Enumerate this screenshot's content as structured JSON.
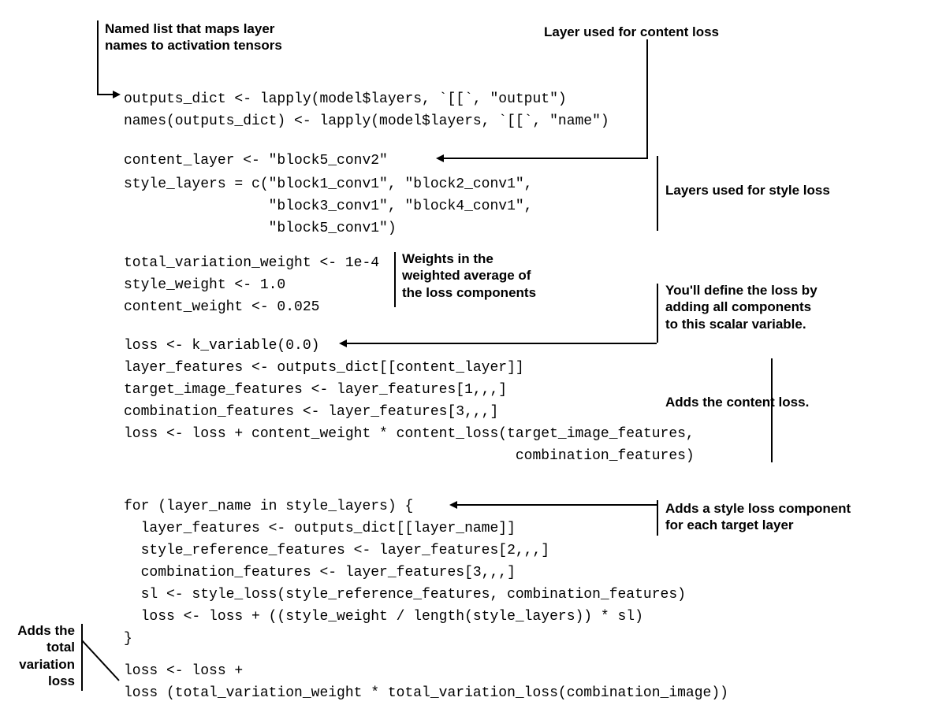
{
  "annotations": {
    "top_left": "Named list that maps layer\nnames to activation tensors",
    "top_right": "Layer used for content loss",
    "style_layers": "Layers used for style loss",
    "weights": "Weights in the\nweighted average of\nthe loss components",
    "scalar_var": "You'll define the loss by\nadding all components\nto this scalar variable.",
    "content_loss": "Adds the content loss.",
    "style_loop": "Adds a style loss component\nfor each target layer",
    "tv_loss": "Adds the\ntotal\nvariation\nloss"
  },
  "code": {
    "l1": "outputs_dict <- lapply(model$layers, `[[`, \"output\")",
    "l2": "names(outputs_dict) <- lapply(model$layers, `[[`, \"name\")",
    "l3": "content_layer <- \"block5_conv2\"",
    "l4": "style_layers = c(\"block1_conv1\", \"block2_conv1\",",
    "l5": "                 \"block3_conv1\", \"block4_conv1\",",
    "l6": "                 \"block5_conv1\")",
    "l7": "total_variation_weight <- 1e-4",
    "l8": "style_weight <- 1.0",
    "l9": "content_weight <- 0.025",
    "l10": "loss <- k_variable(0.0)",
    "l11": "layer_features <- outputs_dict[[content_layer]]",
    "l12": "target_image_features <- layer_features[1,,,]",
    "l13": "combination_features <- layer_features[3,,,]",
    "l14": "loss <- loss + content_weight * content_loss(target_image_features,",
    "l15": "                                              combination_features)",
    "l16": "for (layer_name in style_layers) {",
    "l17": "  layer_features <- outputs_dict[[layer_name]]",
    "l18": "  style_reference_features <- layer_features[2,,,]",
    "l19": "  combination_features <- layer_features[3,,,]",
    "l20": "  sl <- style_loss(style_reference_features, combination_features)",
    "l21": "  loss <- loss + ((style_weight / length(style_layers)) * sl)",
    "l22": "}",
    "l23": "loss <- loss +",
    "l24": "loss (total_variation_weight * total_variation_loss(combination_image))"
  }
}
